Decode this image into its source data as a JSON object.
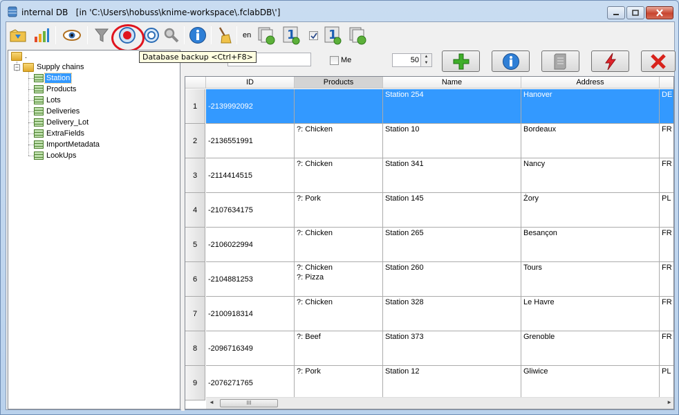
{
  "window": {
    "app_name": "internal DB",
    "path": "[in 'C:\\Users\\hobuss\\knime-workspace\\.fclabDB\\']"
  },
  "toolbar": {
    "language": "en",
    "tooltip": "Database backup <Ctrl+F8>"
  },
  "tree": {
    "root_label": ".",
    "group_label": "Supply chains",
    "items": [
      "Station",
      "Products",
      "Lots",
      "Deliveries",
      "Delivery_Lot",
      "ExtraFields",
      "ImportMetadata",
      "LookUps"
    ],
    "selected": "Station"
  },
  "filter": {
    "me_label": "Me",
    "page_size": "50"
  },
  "table": {
    "columns": [
      "ID",
      "Products",
      "Name",
      "Address",
      ""
    ],
    "rows": [
      {
        "n": "1",
        "id": "-2139992092",
        "products": [
          "",
          ""
        ],
        "name": "Station 254",
        "address": "Hanover",
        "country": "DE"
      },
      {
        "n": "2",
        "id": "-2136551991",
        "products": [
          "?: Chicken",
          ""
        ],
        "name": "Station 10",
        "address": "Bordeaux",
        "country": "FR"
      },
      {
        "n": "3",
        "id": "-2114414515",
        "products": [
          "?: Chicken",
          ""
        ],
        "name": "Station 341",
        "address": "Nancy",
        "country": "FR"
      },
      {
        "n": "4",
        "id": "-2107634175",
        "products": [
          "?: Pork",
          ""
        ],
        "name": "Station 145",
        "address": "Żory",
        "country": "PL"
      },
      {
        "n": "5",
        "id": "-2106022994",
        "products": [
          "?: Chicken",
          ""
        ],
        "name": "Station 265",
        "address": "Besançon",
        "country": "FR"
      },
      {
        "n": "6",
        "id": "-2104881253",
        "products": [
          "?: Chicken",
          "?: Pizza"
        ],
        "name": "Station 260",
        "address": "Tours",
        "country": "FR"
      },
      {
        "n": "7",
        "id": "-2100918314",
        "products": [
          "?: Chicken",
          ""
        ],
        "name": "Station 328",
        "address": "Le Havre",
        "country": "FR"
      },
      {
        "n": "8",
        "id": "-2096716349",
        "products": [
          "?: Beef",
          ""
        ],
        "name": "Station 373",
        "address": "Grenoble",
        "country": "FR"
      },
      {
        "n": "9",
        "id": "-2076271765",
        "products": [
          "?: Pork",
          ""
        ],
        "name": "Station 12",
        "address": "Gliwice",
        "country": "PL"
      }
    ]
  },
  "scrollbar": {
    "thumb_grip": "III"
  },
  "colors": {
    "selection": "#3399ff",
    "highlight_ring": "#e0141e",
    "tooltip_bg": "#ffffe1"
  }
}
